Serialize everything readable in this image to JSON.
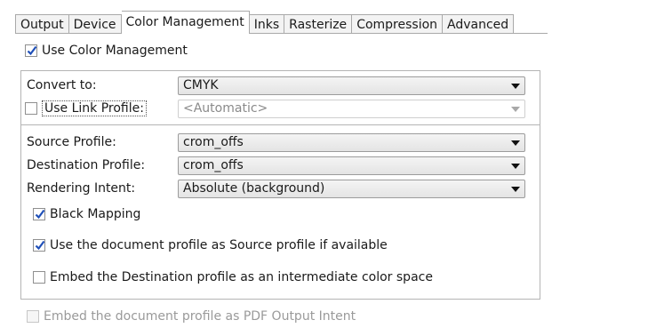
{
  "tabs": [
    {
      "label": "Output",
      "active": false
    },
    {
      "label": "Device",
      "active": false
    },
    {
      "label": "Color Management",
      "active": true
    },
    {
      "label": "Inks",
      "active": false
    },
    {
      "label": "Rasterize",
      "active": false
    },
    {
      "label": "Compression",
      "active": false
    },
    {
      "label": "Advanced",
      "active": false
    }
  ],
  "use_color_management": {
    "label": "Use Color Management",
    "checked": true
  },
  "convert_to": {
    "label": "Convert to:",
    "value": "CMYK"
  },
  "use_link_profile": {
    "label": "Use Link Profile:",
    "checked": false,
    "value": "<Automatic>",
    "enabled": false
  },
  "source_profile": {
    "label": "Source Profile:",
    "value": "crom_offs"
  },
  "destination_profile": {
    "label": "Destination Profile:",
    "value": "crom_offs"
  },
  "rendering_intent": {
    "label": "Rendering Intent:",
    "value": "Absolute (background)"
  },
  "black_mapping": {
    "label": "Black Mapping",
    "checked": true
  },
  "use_doc_profile_source": {
    "label": "Use the document profile as Source profile if available",
    "checked": true
  },
  "embed_destination_profile": {
    "label": "Embed the Destination profile as an intermediate color space",
    "checked": false
  },
  "embed_doc_profile_output_intent": {
    "label": "Embed the document profile as PDF Output Intent",
    "checked": false,
    "enabled": false
  },
  "colors": {
    "checkmark": "#1f4fb8",
    "border": "#b5b5b5"
  }
}
